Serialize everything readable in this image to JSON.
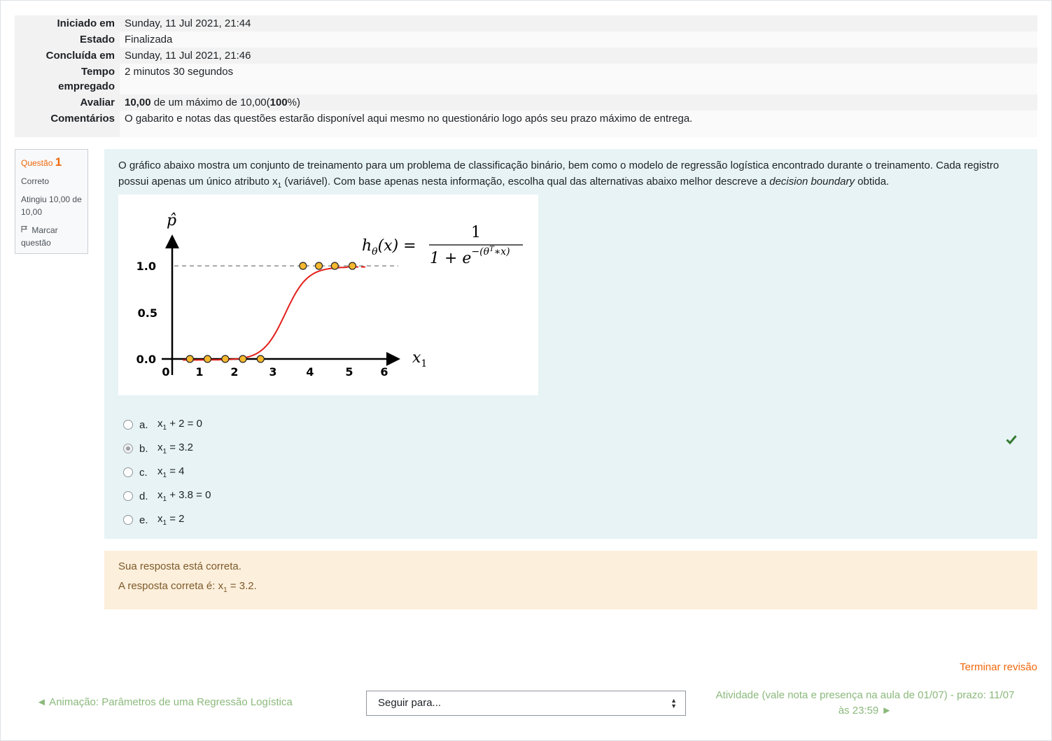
{
  "summary": {
    "rows": [
      {
        "label": "Iniciado em",
        "value": "Sunday, 11 Jul 2021, 21:44"
      },
      {
        "label": "Estado",
        "value": "Finalizada"
      },
      {
        "label": "Concluída em",
        "value": "Sunday, 11 Jul 2021, 21:46"
      },
      {
        "label_line1": "Tempo",
        "label_line2": "empregado",
        "value": "2 minutos 30 segundos"
      },
      {
        "label": "Avaliar",
        "grade": "10,00",
        "mid": " de um máximo de 10,00(",
        "percent": "100",
        "tail": "%)"
      },
      {
        "label": "Comentários",
        "value": "O gabarito e notas das questões estarão disponível aqui mesmo no questionário logo após seu prazo máximo de entrega."
      }
    ]
  },
  "question_info": {
    "prefix": "Questão ",
    "number": "1",
    "state": "Correto",
    "grade": "Atingiu 10,00 de 10,00",
    "flag_label": "Marcar questão",
    "flag_icon": "flag-icon"
  },
  "question": {
    "text_part1": "O gráfico abaixo mostra um conjunto de treinamento para um problema de classificação binário, bem como o modelo de regressão logística encontrado durante o treinamento. Cada registro possui apenas um único atributo x",
    "text_sub": "1",
    "text_part2": " (variável). Com base apenas nesta informação, escolha qual das alternativas abaixo melhor descreve a ",
    "text_italic": "decision boundary",
    "text_part3": " obtida.",
    "figure": {
      "y_axis_label": "p̂",
      "x_axis_label": "x",
      "x_axis_sub": "1",
      "y_ticks": [
        "1.0",
        "0.5",
        "0.0"
      ],
      "x_ticks": [
        "0",
        "1",
        "2",
        "3",
        "4",
        "5",
        "6"
      ],
      "formula_lhs": "h",
      "formula_lhs_sub": "θ",
      "formula_lhs_tail": "(x) =",
      "formula_num": "1",
      "formula_den": "1 + e",
      "formula_exp": "−(θ",
      "formula_exp_sup": "T",
      "formula_exp_tail": "∗x)",
      "points_class0": [
        0.5,
        1.0,
        1.5,
        2.0,
        2.5
      ],
      "points_class1": [
        3.7,
        4.15,
        4.6,
        5.1
      ]
    },
    "answers": [
      {
        "letter": "a.",
        "pre": "x",
        "sub": "1",
        "post": " + 2 = 0",
        "checked": false
      },
      {
        "letter": "b.",
        "pre": "x",
        "sub": "1",
        "post": " = 3.2",
        "checked": true
      },
      {
        "letter": "c.",
        "pre": "x",
        "sub": "1",
        "post": " = 4",
        "checked": false
      },
      {
        "letter": "d.",
        "pre": "x",
        "sub": "1",
        "post": " + 3.8 = 0",
        "checked": false
      },
      {
        "letter": "e.",
        "pre": "x",
        "sub": "1",
        "post": " = 2",
        "checked": false
      }
    ],
    "correct_icon": "checkmark-icon",
    "correct_color": "#357a32"
  },
  "feedback": {
    "message": "Sua resposta está correta.",
    "right_pre": "A resposta correta é: x",
    "right_sub": "1",
    "right_post": " = 3.2."
  },
  "footer": {
    "finish_review": "Terminar revisão",
    "prev_link": "◄ Animação: Parâmetros de uma Regressão Logística",
    "jump_select": "Seguir para...",
    "next_link_line1": "Atividade (vale nota e presença na aula de 01/07) - prazo: 11/07",
    "next_link_line2": "às 23:59 ►"
  },
  "colors": {
    "accent": "#f0680c",
    "link_muted": "#8bb97c",
    "question_bg": "#e7f3f5",
    "feedback_bg": "#fcefdc",
    "curve": "#e3201b",
    "point_fill": "#f5b82e"
  }
}
